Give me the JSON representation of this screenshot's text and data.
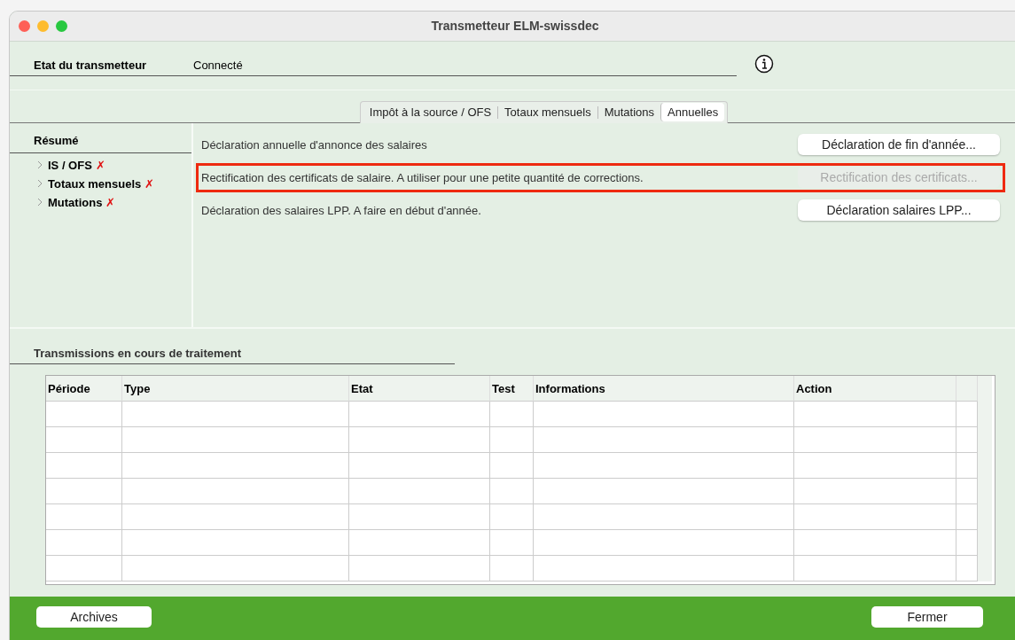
{
  "window": {
    "title": "Transmetteur ELM-swissdec"
  },
  "status": {
    "label": "Etat du transmetteur",
    "value": "Connecté"
  },
  "tabs": [
    {
      "label": "Impôt à la source / OFS",
      "selected": false
    },
    {
      "label": "Totaux mensuels",
      "selected": false
    },
    {
      "label": "Mutations",
      "selected": false
    },
    {
      "label": "Annuelles",
      "selected": true
    }
  ],
  "summary": {
    "title": "Résumé",
    "items": [
      {
        "label": "IS / OFS",
        "mark": "✗"
      },
      {
        "label": "Totaux mensuels",
        "mark": "✗"
      },
      {
        "label": "Mutations",
        "mark": "✗"
      }
    ]
  },
  "actions": [
    {
      "description": "Déclaration annuelle d'annonce des salaires",
      "button": "Déclaration de fin d'année...",
      "disabled": false,
      "highlighted": false
    },
    {
      "description": "Rectification des certificats de salaire. A utiliser pour une petite quantité de corrections.",
      "button": "Rectification des certificats...",
      "disabled": true,
      "highlighted": true
    },
    {
      "description": "Déclaration des salaires LPP. A faire en début d'année.",
      "button": "Déclaration salaires LPP...",
      "disabled": false,
      "highlighted": false
    }
  ],
  "transmissions": {
    "title": "Transmissions en cours de traitement",
    "columns": [
      "Période",
      "Type",
      "Etat",
      "Test",
      "Informations",
      "Action"
    ]
  },
  "footer": {
    "buttons": [
      "Archives",
      "Fermer"
    ]
  }
}
